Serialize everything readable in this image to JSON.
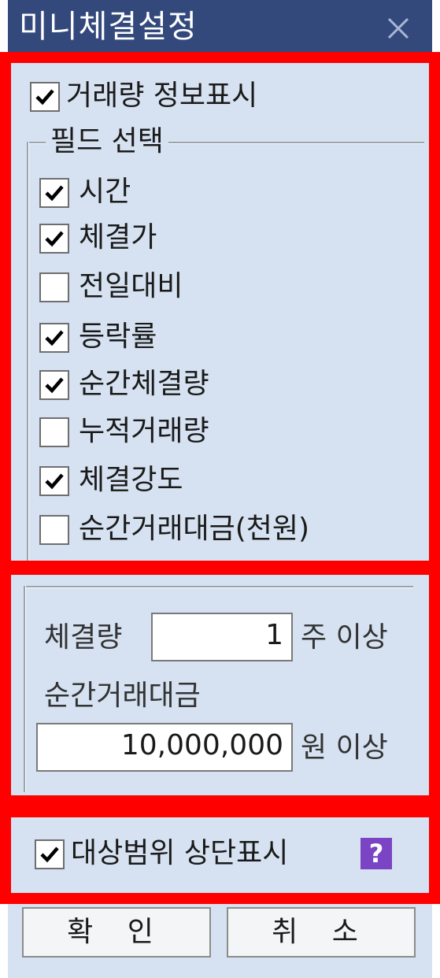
{
  "window": {
    "title": "미니체결설정",
    "close_icon": "close-icon"
  },
  "display": {
    "show_volume_info": {
      "label": "거래량 정보표시",
      "checked": true
    }
  },
  "field_group": {
    "legend": "필드 선택",
    "fields": [
      {
        "label": "시간",
        "checked": true
      },
      {
        "label": "체결가",
        "checked": true
      },
      {
        "label": "전일대비",
        "checked": false
      },
      {
        "label": "등락률",
        "checked": true
      },
      {
        "label": "순간체결량",
        "checked": true
      },
      {
        "label": "누적거래량",
        "checked": false
      },
      {
        "label": "체결강도",
        "checked": true
      },
      {
        "label": "순간거래대금(천원)",
        "checked": false
      }
    ]
  },
  "filters": {
    "volume_label": "체결량",
    "volume_value": "1",
    "volume_suffix": "주 이상",
    "amount_label": "순간거래대금",
    "amount_value": "10,000,000",
    "amount_suffix": "원 이상"
  },
  "target": {
    "label": "대상범위 상단표시",
    "checked": true,
    "help_icon": "?"
  },
  "buttons": {
    "ok": "확 인",
    "cancel": "취 소"
  },
  "colors": {
    "titlebar": "#33497c",
    "body": "#d6e2f1",
    "highlight": "#ff0000",
    "help": "#7b44c4"
  }
}
